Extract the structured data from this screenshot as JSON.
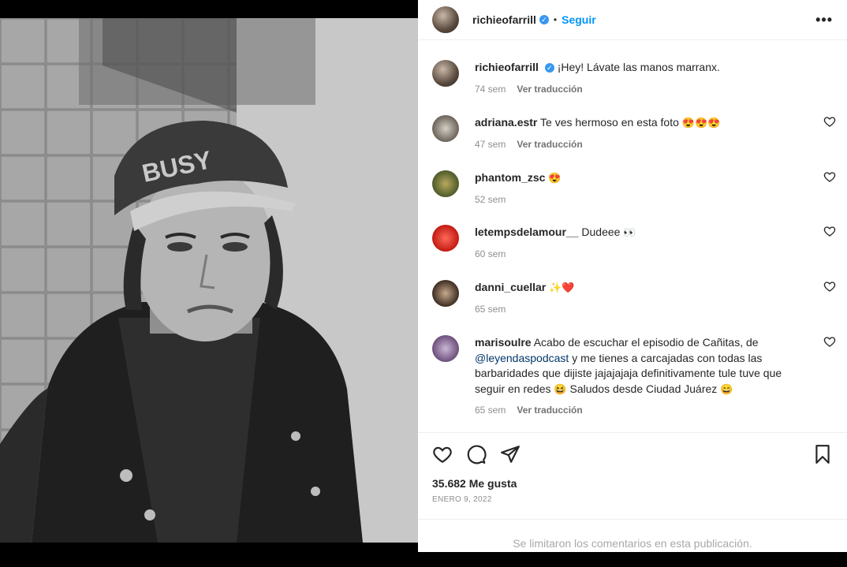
{
  "post": {
    "username": "richieofarrill",
    "follow_label": "Seguir",
    "dot": "•",
    "more_label": "•••"
  },
  "caption": {
    "username": "richieofarrill",
    "text": "¡Hey! Lávate las manos marranx.",
    "time": "74 sem",
    "translate": "Ver traducción"
  },
  "comments": [
    {
      "username": "adriana.estr",
      "text": "Te ves hermoso en esta foto",
      "emoji": "😍😍😍",
      "time": "47 sem",
      "translate": "Ver traducción"
    },
    {
      "username": "phantom_zsc",
      "text": "",
      "emoji": "😍",
      "time": "52 sem",
      "translate": ""
    },
    {
      "username": "letempsdelamour__",
      "text": "Dudeee",
      "emoji": "👀",
      "time": "60 sem",
      "translate": ""
    },
    {
      "username": "danni_cuellar",
      "text": "",
      "emoji": "✨❤️",
      "time": "65 sem",
      "translate": ""
    },
    {
      "username": "marisoulre",
      "text_1": "Acabo de escuchar el episodio de Cañitas, de",
      "mention": "@leyendaspodcast",
      "text_2": "y me tienes a carcajadas con todas las barbaridades que dijiste jajajajaja definitivamente tule tuve que seguir en redes",
      "emoji_1": "😆",
      "text_3": "Saludos desde Ciudad Juárez",
      "emoji_2": "😄",
      "time": "65 sem",
      "translate": "Ver traducción"
    }
  ],
  "likes_label": "35.682 Me gusta",
  "date_label": "ENERO 9, 2022",
  "footer_label": "Se limitaron los comentarios en esta publicación.",
  "photo": {
    "cap_text": "BUSY"
  },
  "icons": [
    "heart-icon",
    "comment-icon",
    "share-icon",
    "bookmark-icon",
    "verified-icon",
    "more-icon"
  ],
  "colors": {
    "accent": "#0095f6",
    "verified": "#3897f0",
    "muted": "#8e8e8e"
  }
}
